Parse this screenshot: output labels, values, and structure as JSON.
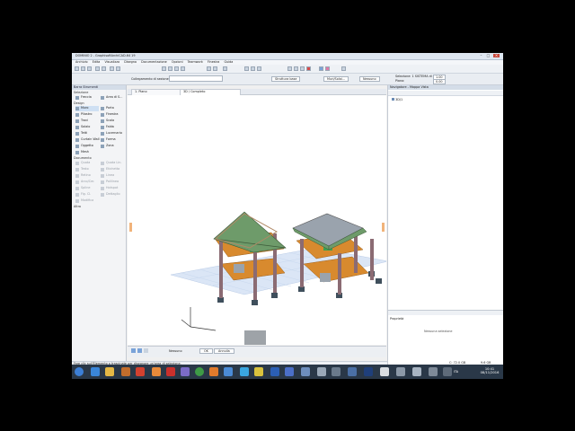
{
  "window": {
    "title": "DOMINIO 2 - GraphisoftArchiCAD-64 19",
    "min_label": "–",
    "max_label": "□",
    "close_label": "×"
  },
  "menu": [
    "Archivio",
    "Edita",
    "Visualizza",
    "Disegna",
    "Documentazione",
    "Opzioni",
    "Teamwork",
    "Finestra",
    "Guida"
  ],
  "toolbar": {
    "stories_label": "Collegamento di sezione",
    "structure_label": "Struttura base",
    "layer_label": "Muri/Solai...",
    "layer_value": "Nessuno",
    "sel_label": "Selezione: 1 SISTEMA di 48a",
    "floor_label": "Piano:",
    "height_label": "1.00",
    "height2_label": "0.00"
  },
  "toolbox": {
    "title": "Barra Strumenti",
    "select_label": "Selezione",
    "tools": [
      "Freccia",
      "Area di S..."
    ],
    "design_header": "Design",
    "design_tools": [
      "Muro",
      "Porta",
      "Pilastro",
      "Finestra",
      "Travi",
      "Scala",
      "Solaio",
      "Falda",
      "Tetti",
      "Lucernario",
      "Curtain Wall",
      "Forma",
      "Oggetto",
      "Zona",
      "Mesh"
    ],
    "doc_header": "Documento",
    "doc_tools": [
      "Quota",
      "Quota Lin.",
      "Testo",
      "Etichetta",
      "Retino",
      "Linea",
      "Arco/Cer.",
      "Polilinea",
      "Spline",
      "Hotspot",
      "Fig. Cl.",
      "Dettaglio",
      "Modifica"
    ],
    "more_header": "Altro"
  },
  "viewport": {
    "tabs": [
      "1. Piano",
      "3D / Completo"
    ]
  },
  "bottom_bar": {
    "zoom_label": "Nessuno",
    "btn1": "OK",
    "btn2": "Annulla"
  },
  "navigator": {
    "title": "Navigatore - Mappa Vista",
    "tree_item": "3D/1",
    "props_title": "Proprietà",
    "props_text": "Nessuna selezione"
  },
  "status": {
    "text": "Fare clic sull'Elemento o trascinate per disegnare un'area di selezione.",
    "drive": "C: 72.0 GB",
    "mem": "9.6 GB"
  },
  "taskbar": {
    "time": "10:41",
    "date": "08/11/2016",
    "lang": "ITA",
    "start_icon": "windows-start-icon",
    "pinned_icons": [
      "ie-icon",
      "folder-icon",
      "media-icon",
      "firefox-icon",
      "autocad-icon",
      "acrobat-icon",
      "word-icon",
      "calculator-icon",
      "chrome-icon",
      "vlc-icon",
      "paint-icon",
      "settings-icon",
      "photo-icon",
      "skype-icon",
      "note-icon",
      "dropbox-icon",
      "word2-icon",
      "teams-icon",
      "archicad-icon",
      "excel-icon",
      "revit-icon",
      "code-icon",
      "pdf-icon",
      "snip-icon",
      "screen-icon",
      "pin-icon"
    ]
  },
  "colors": {
    "roof": "#6e9b6a",
    "floor": "#d88a2e",
    "column": "#8b6b73",
    "grid": "#c9d8ee",
    "taskbar": "#2a3848"
  }
}
